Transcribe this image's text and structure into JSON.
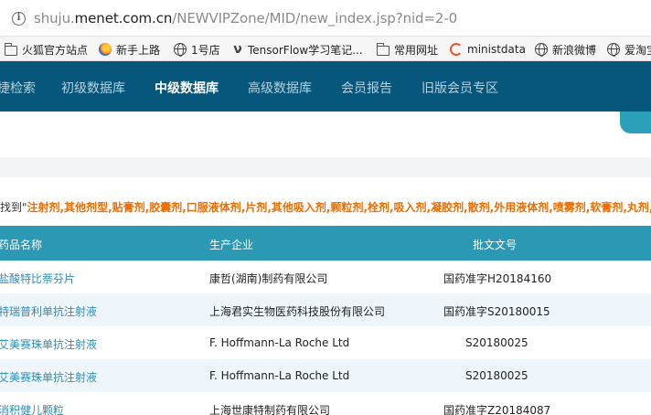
{
  "browser": {
    "url_prefix": "shuju.",
    "url_domain": "menet.com.cn",
    "url_path": "/NEWVIPZone/MID/new_index.jsp?nid=2-0"
  },
  "bookmarks": [
    {
      "label": "火狐官方站点",
      "icon": "folder-icon"
    },
    {
      "label": "新手上路",
      "icon": "firefox-icon"
    },
    {
      "label": "1号店",
      "icon": "globe-icon"
    },
    {
      "label": "TensorFlow学习笔记...",
      "icon": "tensorflow-icon"
    },
    {
      "label": "常用网址",
      "icon": "folder-icon"
    },
    {
      "label": "ministdata",
      "icon": "ministdata-icon"
    },
    {
      "label": "新浪微博",
      "icon": "globe-icon"
    },
    {
      "label": "爱淘宝",
      "icon": "globe-icon"
    }
  ],
  "nav": {
    "items": [
      "捷检索",
      "初级数据库",
      "中级数据库",
      "高级数据库",
      "会员报告",
      "旧版会员专区"
    ],
    "active": "中级数据库"
  },
  "result": {
    "prefix": "找到\"",
    "types": "注射剂,其他剂型,贴膏剂,胶囊剂,口服液体剂,片剂,其他吸入剂,颗粒剂,栓剂,吸入剂,凝胶剂,散剂,外用液体剂,喷雾剂,软膏剂,丸剂,其它"
  },
  "table": {
    "headers": [
      "药品名称",
      "生产企业",
      "批文文号"
    ],
    "rows": [
      {
        "name": "盐酸特比萘芬片",
        "maker": "康哲(湖南)制药有限公司",
        "approval": "国药准字H20184160"
      },
      {
        "name": "特瑞普利单抗注射液",
        "maker": "上海君实生物医药科技股份有限公司",
        "approval": "国药准字S20180015"
      },
      {
        "name": "艾美赛珠单抗注射液",
        "maker": "F. Hoffmann-La Roche Ltd",
        "approval": "S20180025"
      },
      {
        "name": "艾美赛珠单抗注射液",
        "maker": "F. Hoffmann-La Roche Ltd",
        "approval": "S20180025"
      },
      {
        "name": "消积健儿颗粒",
        "maker": "上海世康特制药有限公司",
        "approval": "国药准字Z20184087"
      }
    ]
  },
  "colors": {
    "nav_bg": "#07577c",
    "table_header_bg": "#2b98b4",
    "link": "#2b8cb6",
    "highlight": "#ef6c00"
  }
}
